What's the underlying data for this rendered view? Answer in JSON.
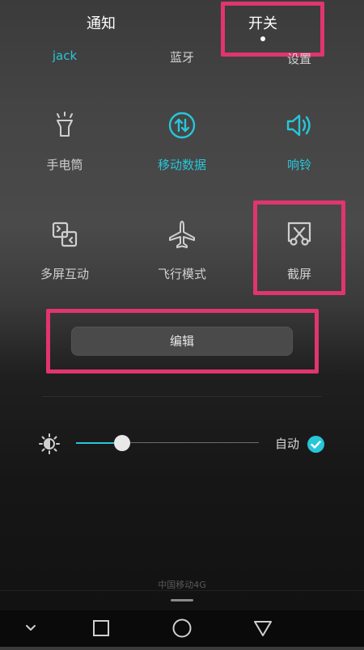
{
  "tabs": {
    "notifications": "通知",
    "switches": "开关"
  },
  "top_row": {
    "left": "jack",
    "middle": "蓝牙",
    "right": "设置"
  },
  "toggles": [
    {
      "label": "手电筒",
      "icon": "flashlight-icon",
      "active": false
    },
    {
      "label": "移动数据",
      "icon": "mobile-data-icon",
      "active": true
    },
    {
      "label": "响铃",
      "icon": "ring-icon",
      "active": true
    },
    {
      "label": "多屏互动",
      "icon": "multiscreen-icon",
      "active": false
    },
    {
      "label": "飞行模式",
      "icon": "airplane-icon",
      "active": false
    },
    {
      "label": "截屏",
      "icon": "screenshot-icon",
      "active": false
    }
  ],
  "edit_button": "编辑",
  "brightness": {
    "level": 0.24,
    "auto_label": "自动",
    "auto_checked": true
  },
  "carrier": "中国移动4G",
  "colors": {
    "accent": "#27c6d9",
    "highlight": "#e0356f"
  }
}
